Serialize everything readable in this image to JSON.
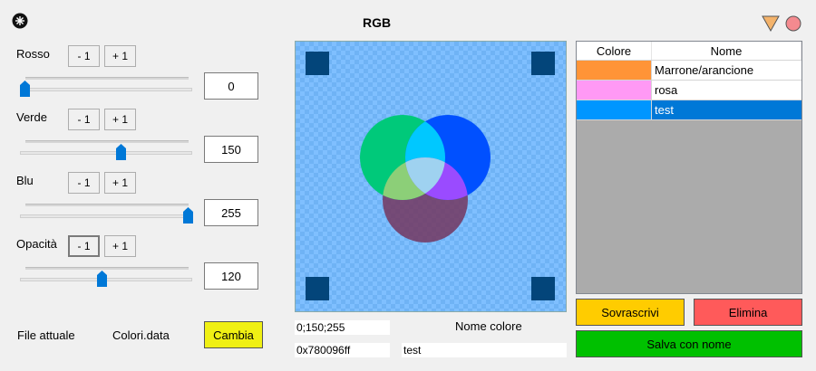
{
  "window": {
    "title": "RGB",
    "app_icon": "app-logo-icon",
    "minimize_icon": "triangle-down-icon",
    "close_icon": "red-circle-icon",
    "minimize_color": "#f4b36b",
    "close_color": "#f48a8f"
  },
  "sliders": [
    {
      "label": "Rosso",
      "minus": "- 1",
      "plus": "+ 1",
      "value": "0",
      "fraction": 0.0
    },
    {
      "label": "Verde",
      "minus": "- 1",
      "plus": "+ 1",
      "value": "150",
      "fraction": 0.588
    },
    {
      "label": "Blu",
      "minus": "- 1",
      "plus": "+ 1",
      "value": "255",
      "fraction": 1.0
    },
    {
      "label": "Opacità",
      "minus": "- 1",
      "plus": "+ 1",
      "value": "120",
      "fraction": 0.471
    }
  ],
  "file": {
    "label": "File attuale",
    "name": "Colori.data",
    "change_button": "Cambia"
  },
  "preview": {
    "rgb_readout": "0;150;255",
    "hex_readout": "0x780096ff",
    "name_label": "Nome colore",
    "name_value": "test"
  },
  "table": {
    "headers": [
      "Colore",
      "Nome"
    ],
    "rows": [
      {
        "color": "#ff9437",
        "name": "Marrone/arancione",
        "selected": false
      },
      {
        "color": "#ff99f5",
        "name": "rosa",
        "selected": false
      },
      {
        "color": "#0096ff",
        "name": "test",
        "selected": true
      }
    ]
  },
  "actions": {
    "overwrite": "Sovrascrivi",
    "delete": "Elimina",
    "save_as": "Salva con nome"
  },
  "colors": {
    "accent": "#0078d7",
    "change_button_bg": "#f0f014",
    "overwrite_bg": "#ffcc00",
    "delete_bg": "#ff5a5a",
    "save_bg": "#00c000"
  }
}
